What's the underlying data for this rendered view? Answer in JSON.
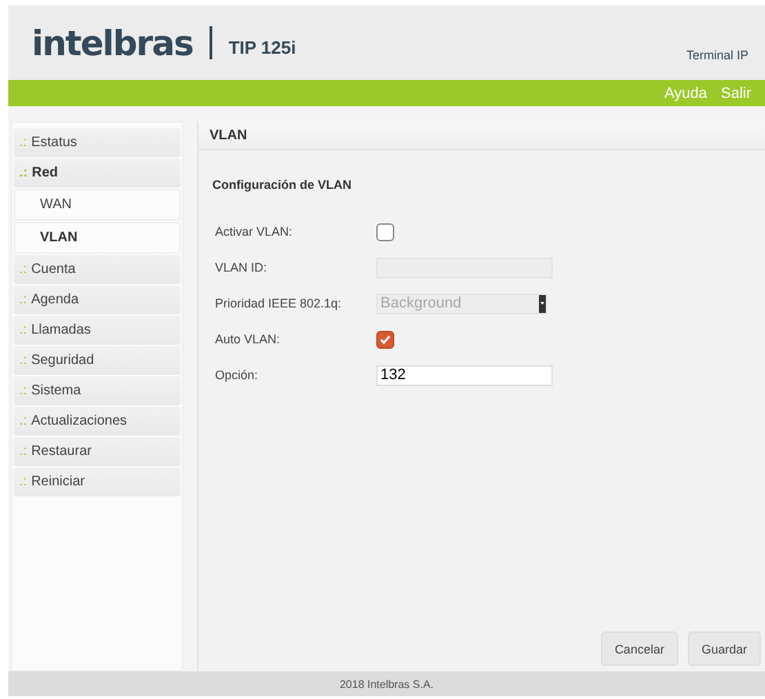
{
  "header": {
    "logo": "intelbras",
    "model": "TIP 125i",
    "subtitle": "Terminal IP"
  },
  "topbar": {
    "links": [
      "Ayuda",
      "Salir"
    ]
  },
  "sidebar": {
    "items": [
      {
        "marker": ".:",
        "label": "Estatus",
        "selected": false
      },
      {
        "marker": ".:",
        "label": "Red",
        "selected": true,
        "children": [
          {
            "label": "WAN",
            "selected": false
          },
          {
            "label": "VLAN",
            "selected": true
          }
        ]
      },
      {
        "marker": ".:",
        "label": "Cuenta",
        "selected": false
      },
      {
        "marker": ".:",
        "label": "Agenda",
        "selected": false
      },
      {
        "marker": ".:",
        "label": "Llamadas",
        "selected": false
      },
      {
        "marker": ".:",
        "label": "Seguridad",
        "selected": false
      },
      {
        "marker": ".:",
        "label": "Sistema",
        "selected": false
      },
      {
        "marker": ".:",
        "label": "Actualizaciones",
        "selected": false
      },
      {
        "marker": ".:",
        "label": "Restaurar",
        "selected": false
      },
      {
        "marker": ".:",
        "label": "Reiniciar",
        "selected": false
      }
    ]
  },
  "panel": {
    "title": "VLAN",
    "section": "Configuración de VLAN",
    "fields": [
      {
        "kind": "checkbox",
        "label": "Activar VLAN:",
        "checked": false
      },
      {
        "kind": "text",
        "label": "VLAN ID:",
        "disabled": true
      },
      {
        "kind": "select",
        "label": "Prioridad IEEE 802.1q:",
        "value": "Background",
        "disabled": true
      },
      {
        "kind": "checkbox",
        "label": "Auto VLAN:",
        "checked": true
      },
      {
        "kind": "text",
        "label": "Opción:",
        "value": "132",
        "disabled": false
      }
    ],
    "buttons": [
      "Cancelar",
      "Guardar"
    ]
  },
  "footer": "2018 Intelbras S.A."
}
